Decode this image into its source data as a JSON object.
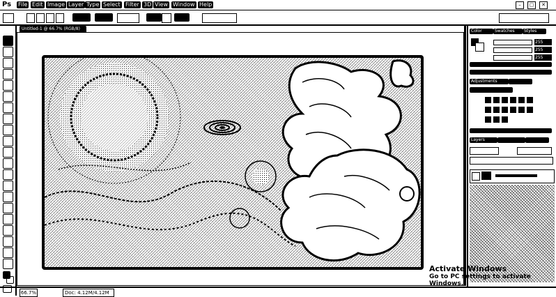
{
  "app": {
    "logo_text": "Ps"
  },
  "menu": [
    "File",
    "Edit",
    "Image",
    "Layer",
    "Type",
    "Select",
    "Filter",
    "3D",
    "View",
    "Window",
    "Help"
  ],
  "window_controls": [
    "–",
    "▢",
    "✕"
  ],
  "document": {
    "tab_title": "Untitled-1 @ 66.7% (RGB/8)"
  },
  "status": {
    "zoom": "66.7%",
    "doc_info": "Doc: 4.12M/4.12M"
  },
  "panels": {
    "color_tab": "Color",
    "swatches_tab": "Swatches",
    "styles_tab": "Styles",
    "adjustments_tab": "Adjustments",
    "layers_tab": "Layers",
    "slider_values": [
      "255",
      "255",
      "255"
    ]
  },
  "watermark": {
    "line1": "Activate Windows",
    "line2": "Go to PC settings to activate Windows."
  }
}
